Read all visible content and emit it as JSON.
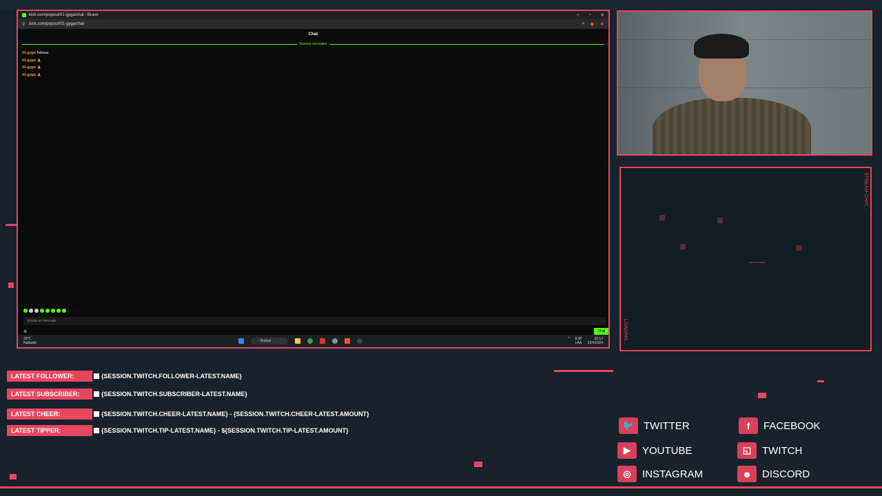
{
  "browser": {
    "title": "kick.com/popout/01-gyga/chat - Brave",
    "url": "kick.com/popout/01-gyga/chat",
    "chat_title": "Chat",
    "new_messages_label": "Nuevos mensajes",
    "messages": [
      {
        "user": "01-gyga",
        "text": "holiwas"
      },
      {
        "user": "01-gyga",
        "text": "🙏"
      },
      {
        "user": "01-gyga",
        "text": "🙏"
      },
      {
        "user": "01-gyga",
        "text": "🙏"
      }
    ],
    "input_placeholder": "Enviar un mensaje",
    "chat_button": "Chat"
  },
  "taskbar": {
    "weather_temp": "23°C",
    "weather_desc": "Nublado",
    "search_label": "Buscar",
    "lang_top": "ESP",
    "lang_bottom": "LAA",
    "time": "20:12",
    "date": "22/4/2024"
  },
  "stream": {
    "chat_panel_top_label": "STREAM CHAT...",
    "chat_panel_bottom_label": "LOADING...",
    "latest": [
      {
        "label": "LATEST FOLLOWER:",
        "value": "{SESSION.TWITCH.FOLLOWER-LATEST.NAME}"
      },
      {
        "label": "LATEST SUBSCRIBER:",
        "value": "{SESSION.TWITCH.SUBSCRIBER-LATEST.NAME}"
      },
      {
        "label": "LATEST CHEER:",
        "value": "{SESSION.TWITCH.CHEER-LATEST.NAME} - {SESSION.TWITCH.CHEER-LATEST.AMOUNT}"
      },
      {
        "label": "LATEST TIPPER:",
        "value": "{SESSION.TWITCH.TIP-LATEST.NAME} - ${SESSION.TWITCH.TIP-LATEST.AMOUNT}"
      }
    ],
    "socials": [
      {
        "name": "TWITTER",
        "icon": "twitter-icon"
      },
      {
        "name": "FACEBOOK",
        "icon": "facebook-icon"
      },
      {
        "name": "YOUTUBE",
        "icon": "youtube-icon"
      },
      {
        "name": "TWITCH",
        "icon": "twitch-icon"
      },
      {
        "name": "INSTAGRAM",
        "icon": "instagram-icon"
      },
      {
        "name": "DISCORD",
        "icon": "discord-icon"
      }
    ]
  },
  "colors": {
    "accent": "#e8465f",
    "kick_green": "#53fc18",
    "background": "#18222c"
  }
}
